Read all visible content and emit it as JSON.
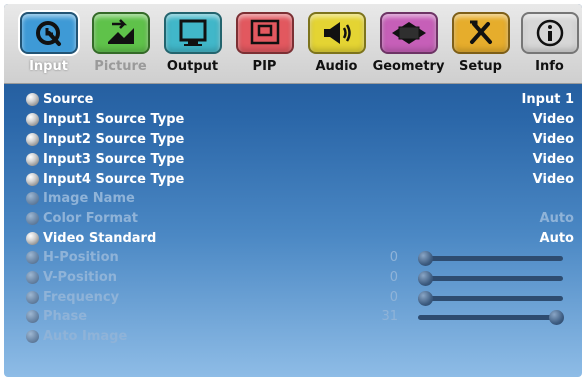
{
  "tabs": [
    {
      "label": "Input",
      "icon": "input-arrow-icon",
      "color": "#3e9ad6",
      "state": "active"
    },
    {
      "label": "Picture",
      "icon": "picture-adjust-icon",
      "color": "#5fc24a",
      "state": "disabled"
    },
    {
      "label": "Output",
      "icon": "monitor-icon",
      "color": "#41b7c9",
      "state": "normal"
    },
    {
      "label": "PIP",
      "icon": "pip-window-icon",
      "color": "#e2585f",
      "state": "normal"
    },
    {
      "label": "Audio",
      "icon": "speaker-icon",
      "color": "#e4d433",
      "state": "normal"
    },
    {
      "label": "Geometry",
      "icon": "geometry-icon",
      "color": "#c65fb8",
      "state": "normal"
    },
    {
      "label": "Setup",
      "icon": "tools-icon",
      "color": "#e6ad2c",
      "state": "normal"
    },
    {
      "label": "Info",
      "icon": "info-icon",
      "color": "#d7d7d7",
      "state": "normal"
    }
  ],
  "menu": [
    {
      "label": "Source",
      "value": "Input 1",
      "enabled": true
    },
    {
      "label": "Input1 Source Type",
      "value": "Video",
      "enabled": true
    },
    {
      "label": "Input2 Source Type",
      "value": "Video",
      "enabled": true
    },
    {
      "label": "Input3 Source Type",
      "value": "Video",
      "enabled": true
    },
    {
      "label": "Input4 Source Type",
      "value": "Video",
      "enabled": true
    },
    {
      "label": "Image Name",
      "value": "",
      "enabled": false
    },
    {
      "label": "Color Format",
      "value": "Auto",
      "enabled": false
    },
    {
      "label": "Video Standard",
      "value": "Auto",
      "enabled": true
    },
    {
      "label": "H-Position",
      "number": "0",
      "slider_fraction": 0.0,
      "enabled": false
    },
    {
      "label": "V-Position",
      "number": "0",
      "slider_fraction": 0.0,
      "enabled": false
    },
    {
      "label": "Frequency",
      "number": "0",
      "slider_fraction": 0.0,
      "enabled": false
    },
    {
      "label": "Phase",
      "number": "31",
      "slider_fraction": 1.0,
      "enabled": false
    },
    {
      "label": "Auto Image",
      "value": "",
      "enabled": false
    }
  ]
}
